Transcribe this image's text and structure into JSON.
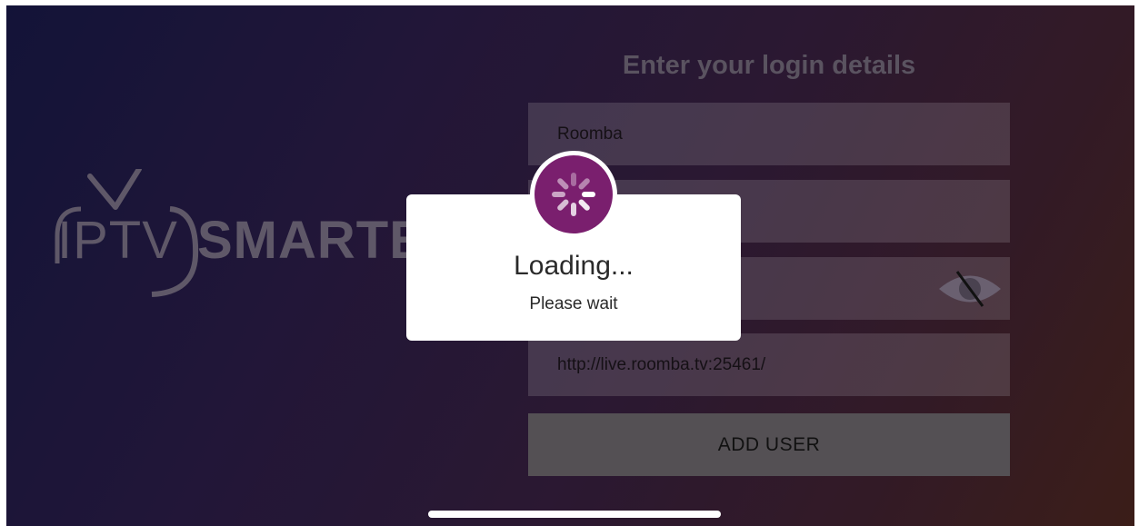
{
  "logo": {
    "text_light": "IPTV",
    "text_bold": "SMARTE"
  },
  "form": {
    "heading": "Enter your login details",
    "username_value": "Roomba",
    "password_visibility_icon": "eye-slash-icon",
    "url_value": "http://live.roomba.tv:25461/",
    "add_user_label": "ADD USER"
  },
  "dialog": {
    "title": "Loading...",
    "subtitle": "Please wait",
    "spinner_icon": "activity-spinner-icon",
    "spinner_color": "#7a1f6e"
  },
  "colors": {
    "background_start": "#161640",
    "background_end": "#44221c",
    "button_bg": "#545054"
  }
}
